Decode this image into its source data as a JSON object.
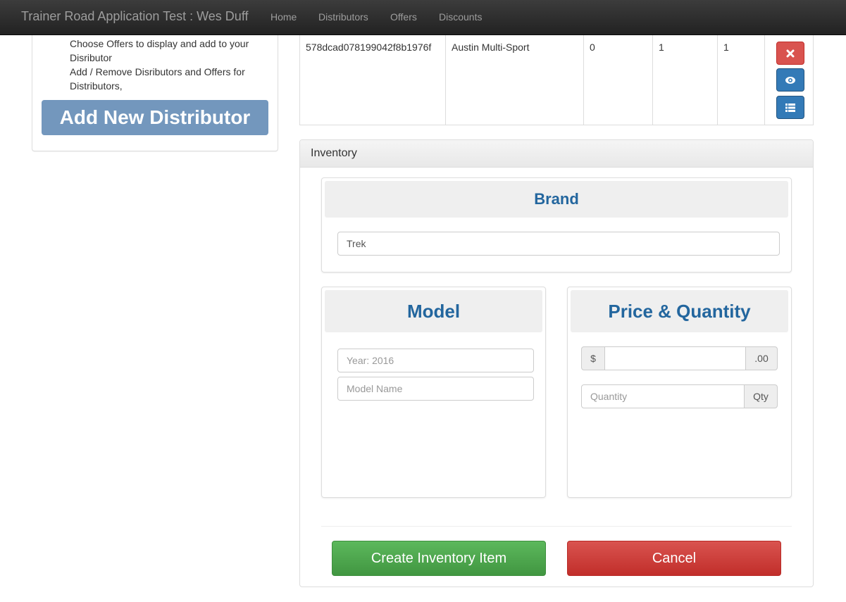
{
  "navbar": {
    "brand": "Trainer Road Application Test : Wes Duff",
    "links": [
      "Home",
      "Distributors",
      "Offers",
      "Discounts"
    ]
  },
  "sidebar": {
    "lines": [
      "Choose Offers to display and add to your",
      "Disributor",
      "Add / Remove Disributors and Offers for",
      "Distributors,"
    ],
    "add_button": "Add New Distributor"
  },
  "distributor_row": {
    "id": "578dcad078199042f8b1976f",
    "name": "Austin Multi-Sport",
    "col3": "0",
    "col4": "1",
    "col5": "1",
    "actions": [
      "delete-icon",
      "view-icon",
      "list-icon"
    ]
  },
  "inventory": {
    "heading": "Inventory",
    "brand": {
      "title": "Brand",
      "value": "Trek"
    },
    "model": {
      "title": "Model",
      "year_placeholder": "Year: 2016",
      "name_placeholder": "Model Name"
    },
    "price_quantity": {
      "title": "Price & Quantity",
      "currency_prefix": "$",
      "cents_suffix": ".00",
      "quantity_placeholder": "Quantity",
      "quantity_suffix": "Qty"
    },
    "create_button": "Create Inventory Item",
    "cancel_button": "Cancel"
  },
  "colors": {
    "navbar": "#222222",
    "heading_blue": "#23669e",
    "add_button": "#7397bd",
    "success": "#5cb85c",
    "danger": "#d9534f",
    "primary": "#337ab7"
  }
}
